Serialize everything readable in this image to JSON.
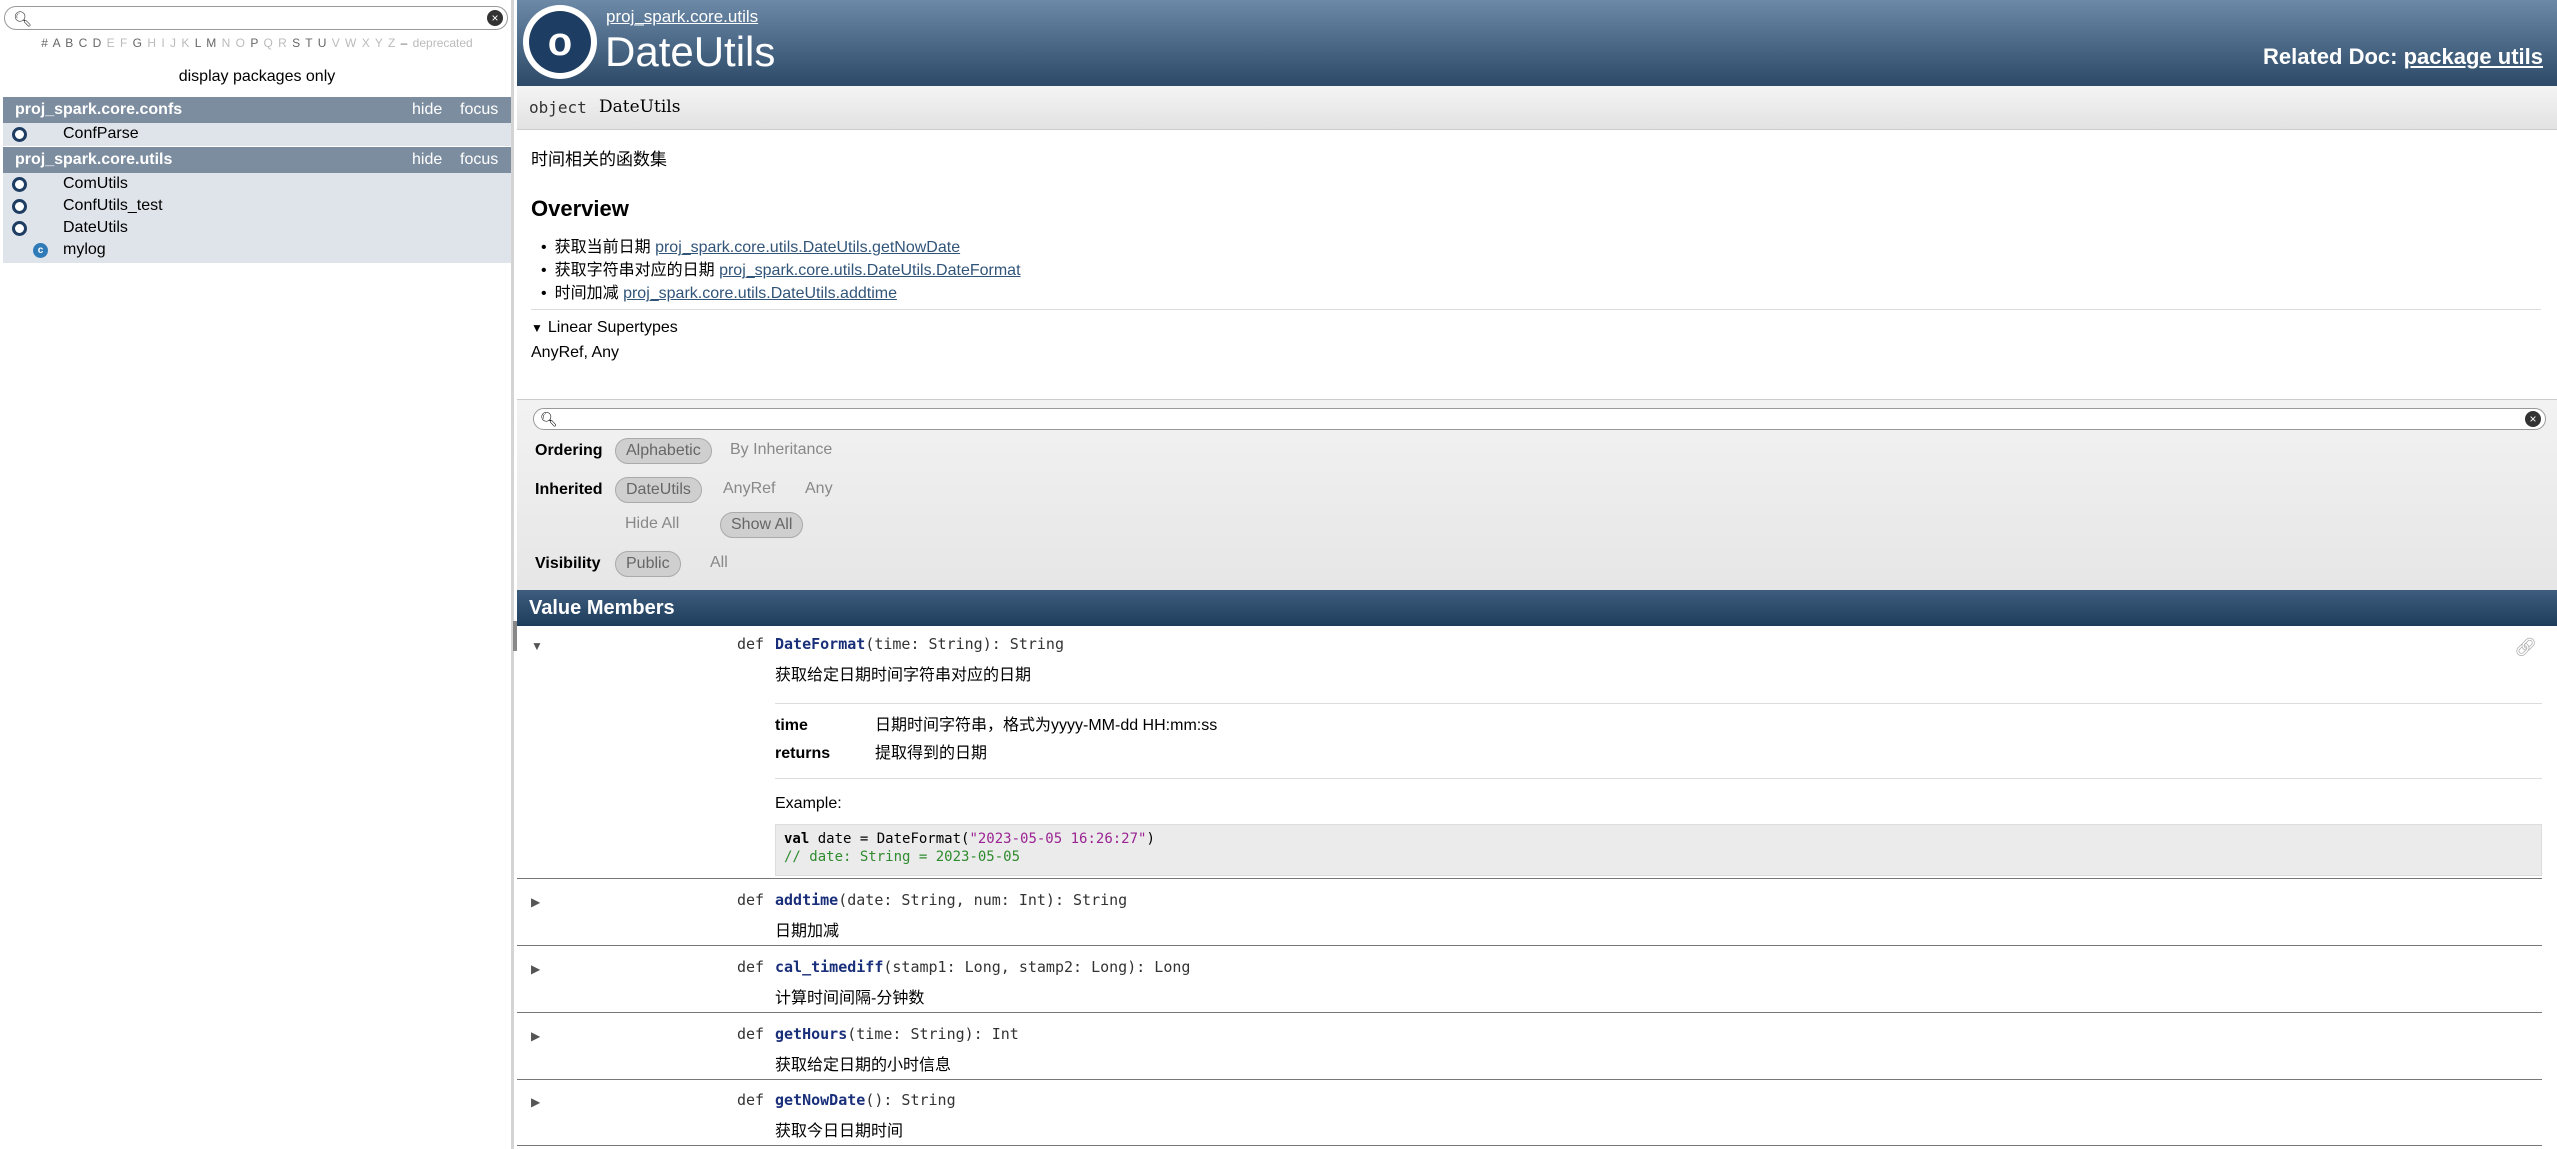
{
  "sidebar": {
    "search_placeholder": "",
    "letters_active": "# A B C D",
    "letters_dim1": "E F",
    "letters_active2": "G",
    "letters_dim2": "H I J K",
    "letters_active3": "L M",
    "letters_dim3": "N O",
    "letters_active4": "P",
    "letters_dim4": "Q R",
    "letters_active5": "S T U",
    "letters_dim5": "V W X Y Z",
    "letters_dash": "–",
    "deprecated": "deprecated",
    "display_packages": "display packages only",
    "hide_label": "hide",
    "focus_label": "focus",
    "packages": [
      {
        "name": "proj_spark.core.confs",
        "entities": [
          {
            "name": "ConfParse",
            "kind": "object"
          }
        ]
      },
      {
        "name": "proj_spark.core.utils",
        "entities": [
          {
            "name": "ComUtils",
            "kind": "object"
          },
          {
            "name": "ConfUtils_test",
            "kind": "object"
          },
          {
            "name": "DateUtils",
            "kind": "object"
          },
          {
            "name": "mylog",
            "kind": "class"
          }
        ]
      }
    ]
  },
  "header": {
    "icon_letter": "o",
    "breadcrumb": "proj_spark.core.utils",
    "title": "DateUtils",
    "related_label": "Related Doc:",
    "related_link": "package utils"
  },
  "signature": {
    "keyword": "object",
    "name": "DateUtils"
  },
  "comment": "时间相关的函数集",
  "overview": {
    "heading": "Overview",
    "items": [
      {
        "text": "获取当前日期",
        "link": "proj_spark.core.utils.DateUtils.getNowDate"
      },
      {
        "text": "获取字符串对应的日期",
        "link": "proj_spark.core.utils.DateUtils.DateFormat"
      },
      {
        "text": "时间加减",
        "link": "proj_spark.core.utils.DateUtils.addtime"
      }
    ]
  },
  "supertypes": {
    "label": "Linear Supertypes",
    "values": "AnyRef, Any"
  },
  "filter": {
    "search_placeholder": "",
    "ordering_label": "Ordering",
    "ordering_alpha": "Alphabetic",
    "ordering_inherit": "By Inheritance",
    "inherited_label": "Inherited",
    "inherited_dateutils": "DateUtils",
    "inherited_anyref": "AnyRef",
    "inherited_any": "Any",
    "hide_all": "Hide All",
    "show_all": "Show All",
    "visibility_label": "Visibility",
    "visibility_public": "Public",
    "visibility_all": "All"
  },
  "value_members": {
    "heading": "Value Members",
    "def_kw": "def",
    "members": [
      {
        "name": "DateFormat",
        "params": "(time: String): String",
        "desc": "获取给定日期时间字符串对应的日期",
        "expanded": true
      },
      {
        "name": "addtime",
        "params": "(date: String, num: Int): String",
        "desc": "日期加减",
        "expanded": false
      },
      {
        "name": "cal_timediff",
        "params": "(stamp1: Long, stamp2: Long): Long",
        "desc": "计算时间间隔-分钟数",
        "expanded": false
      },
      {
        "name": "getHours",
        "params": "(time: String): Int",
        "desc": "获取给定日期的小时信息",
        "expanded": false
      },
      {
        "name": "getNowDate",
        "params": "(): String",
        "desc": "获取今日日期时间",
        "expanded": false
      }
    ],
    "detail": {
      "param_time_label": "time",
      "param_time_desc": "日期时间字符串，格式为yyyy-MM-dd HH:mm:ss",
      "returns_label": "returns",
      "returns_desc": "提取得到的日期",
      "example_label": "Example:",
      "code_kw": "val",
      "code_mid": " date = DateFormat(",
      "code_str": "\"2023-05-05 16:26:27\"",
      "code_end": ")",
      "code_comment": "// date: String = 2023-05-05"
    }
  }
}
